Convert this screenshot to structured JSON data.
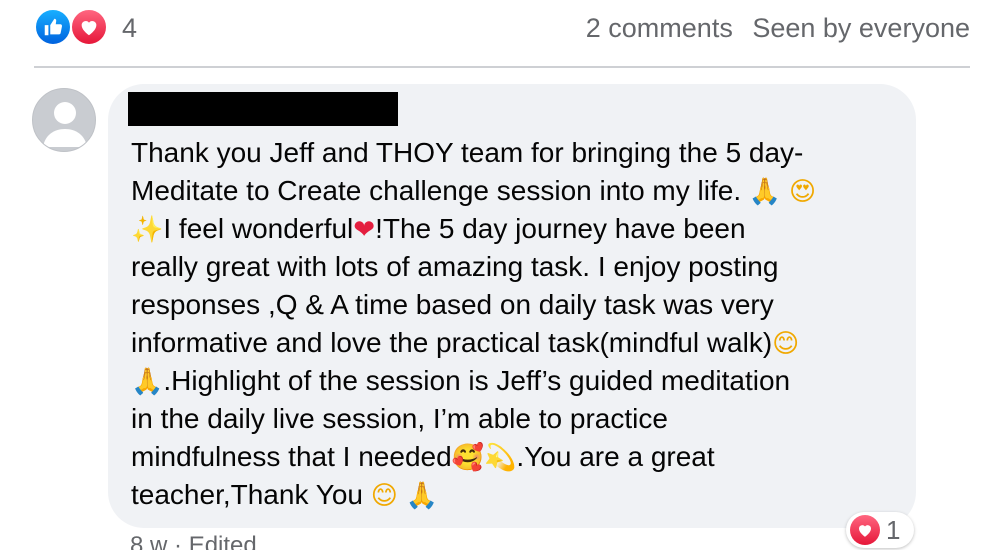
{
  "post_summary": {
    "reaction_count": "4",
    "reaction_types": [
      "like-icon",
      "love-icon"
    ],
    "comments_label": "2 comments",
    "seen_label": "Seen by everyone"
  },
  "comment": {
    "author_redacted": true,
    "lines": [
      "Thank you Jeff and THOY team for bringing the 5 day-",
      "Meditate to Create challenge session into my life. ",
      "I feel wonderful",
      "!The 5 day journey have been",
      "really great with lots of amazing task. I enjoy posting",
      "responses ,Q & A time based on daily task was very",
      "informative and love the practical task(mindful walk)",
      ".Highlight of the session is Jeff’s guided meditation",
      "in the daily live session, I’m able to practice",
      "mindfulness that I needed",
      ".You are a great",
      "teacher,Thank You "
    ],
    "reaction_count": "1",
    "time_label": "8 w",
    "separator": "·",
    "edited_label": "Edited"
  },
  "colors": {
    "like": "#0866ff",
    "love": "#e41e3f",
    "bubble_bg": "#f0f2f5",
    "meta_text": "#65676b"
  }
}
